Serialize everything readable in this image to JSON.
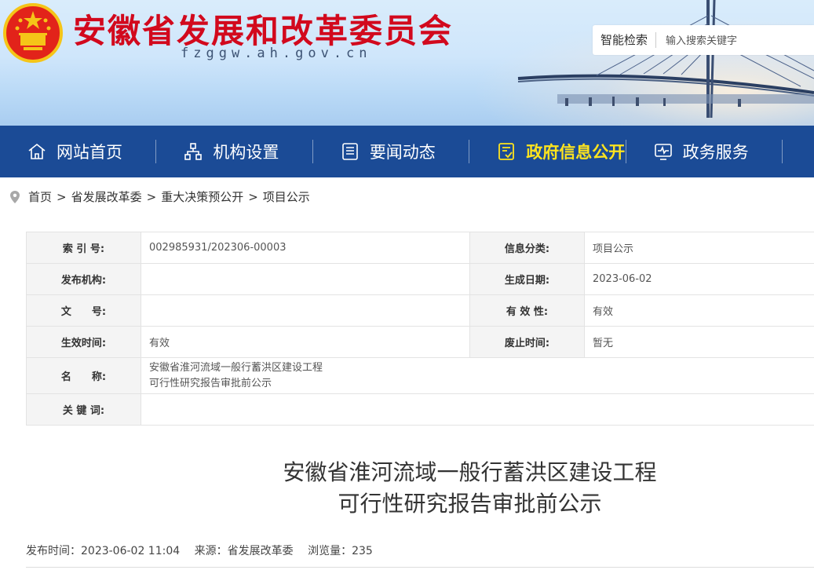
{
  "header": {
    "site_title": "安徽省发展和改革委员会",
    "site_domain": "fzggw.ah.gov.cn",
    "search_label": "智能检索",
    "search_placeholder": "输入搜索关键字"
  },
  "nav": {
    "items": [
      {
        "label": "网站首页",
        "icon": "home-icon"
      },
      {
        "label": "机构设置",
        "icon": "org-chart-icon"
      },
      {
        "label": "要闻动态",
        "icon": "news-icon"
      },
      {
        "label": "政府信息公开",
        "icon": "document-check-icon",
        "active": true
      },
      {
        "label": "政务服务",
        "icon": "monitor-pulse-icon"
      }
    ]
  },
  "breadcrumb": {
    "items": [
      "首页",
      "省发展改革委",
      "重大决策预公开",
      "项目公示"
    ],
    "separator": ">"
  },
  "info_table": {
    "index_label": "索 引 号:",
    "index_value": "002985931/202306-00003",
    "category_label": "信息分类:",
    "category_value": "项目公示",
    "publisher_label": "发布机构:",
    "publisher_value": "",
    "date_label": "生成日期:",
    "date_value": "2023-06-02",
    "docno_label": "文　　号:",
    "docno_value": "",
    "validity_label": "有 效 性:",
    "validity_value": "有效",
    "effective_label": "生效时间:",
    "effective_value": "有效",
    "abolish_label": "废止时间:",
    "abolish_value": "暂无",
    "name_label": "名　　称:",
    "name_line1": "安徽省淮河流域一般行蓄洪区建设工程",
    "name_line2": "可行性研究报告审批前公示",
    "keywords_label": "关 键 词:",
    "keywords_value": ""
  },
  "article": {
    "title_line1": "安徽省淮河流域一般行蓄洪区建设工程",
    "title_line2": "可行性研究报告审批前公示",
    "publish_time": "发布时间：2023-06-02 11:04",
    "source": "来源：省发展改革委",
    "views": "浏览量：235"
  },
  "colors": {
    "brand_red": "#d2091d",
    "nav_blue": "#1b4b96",
    "nav_active": "#ffe41e"
  }
}
